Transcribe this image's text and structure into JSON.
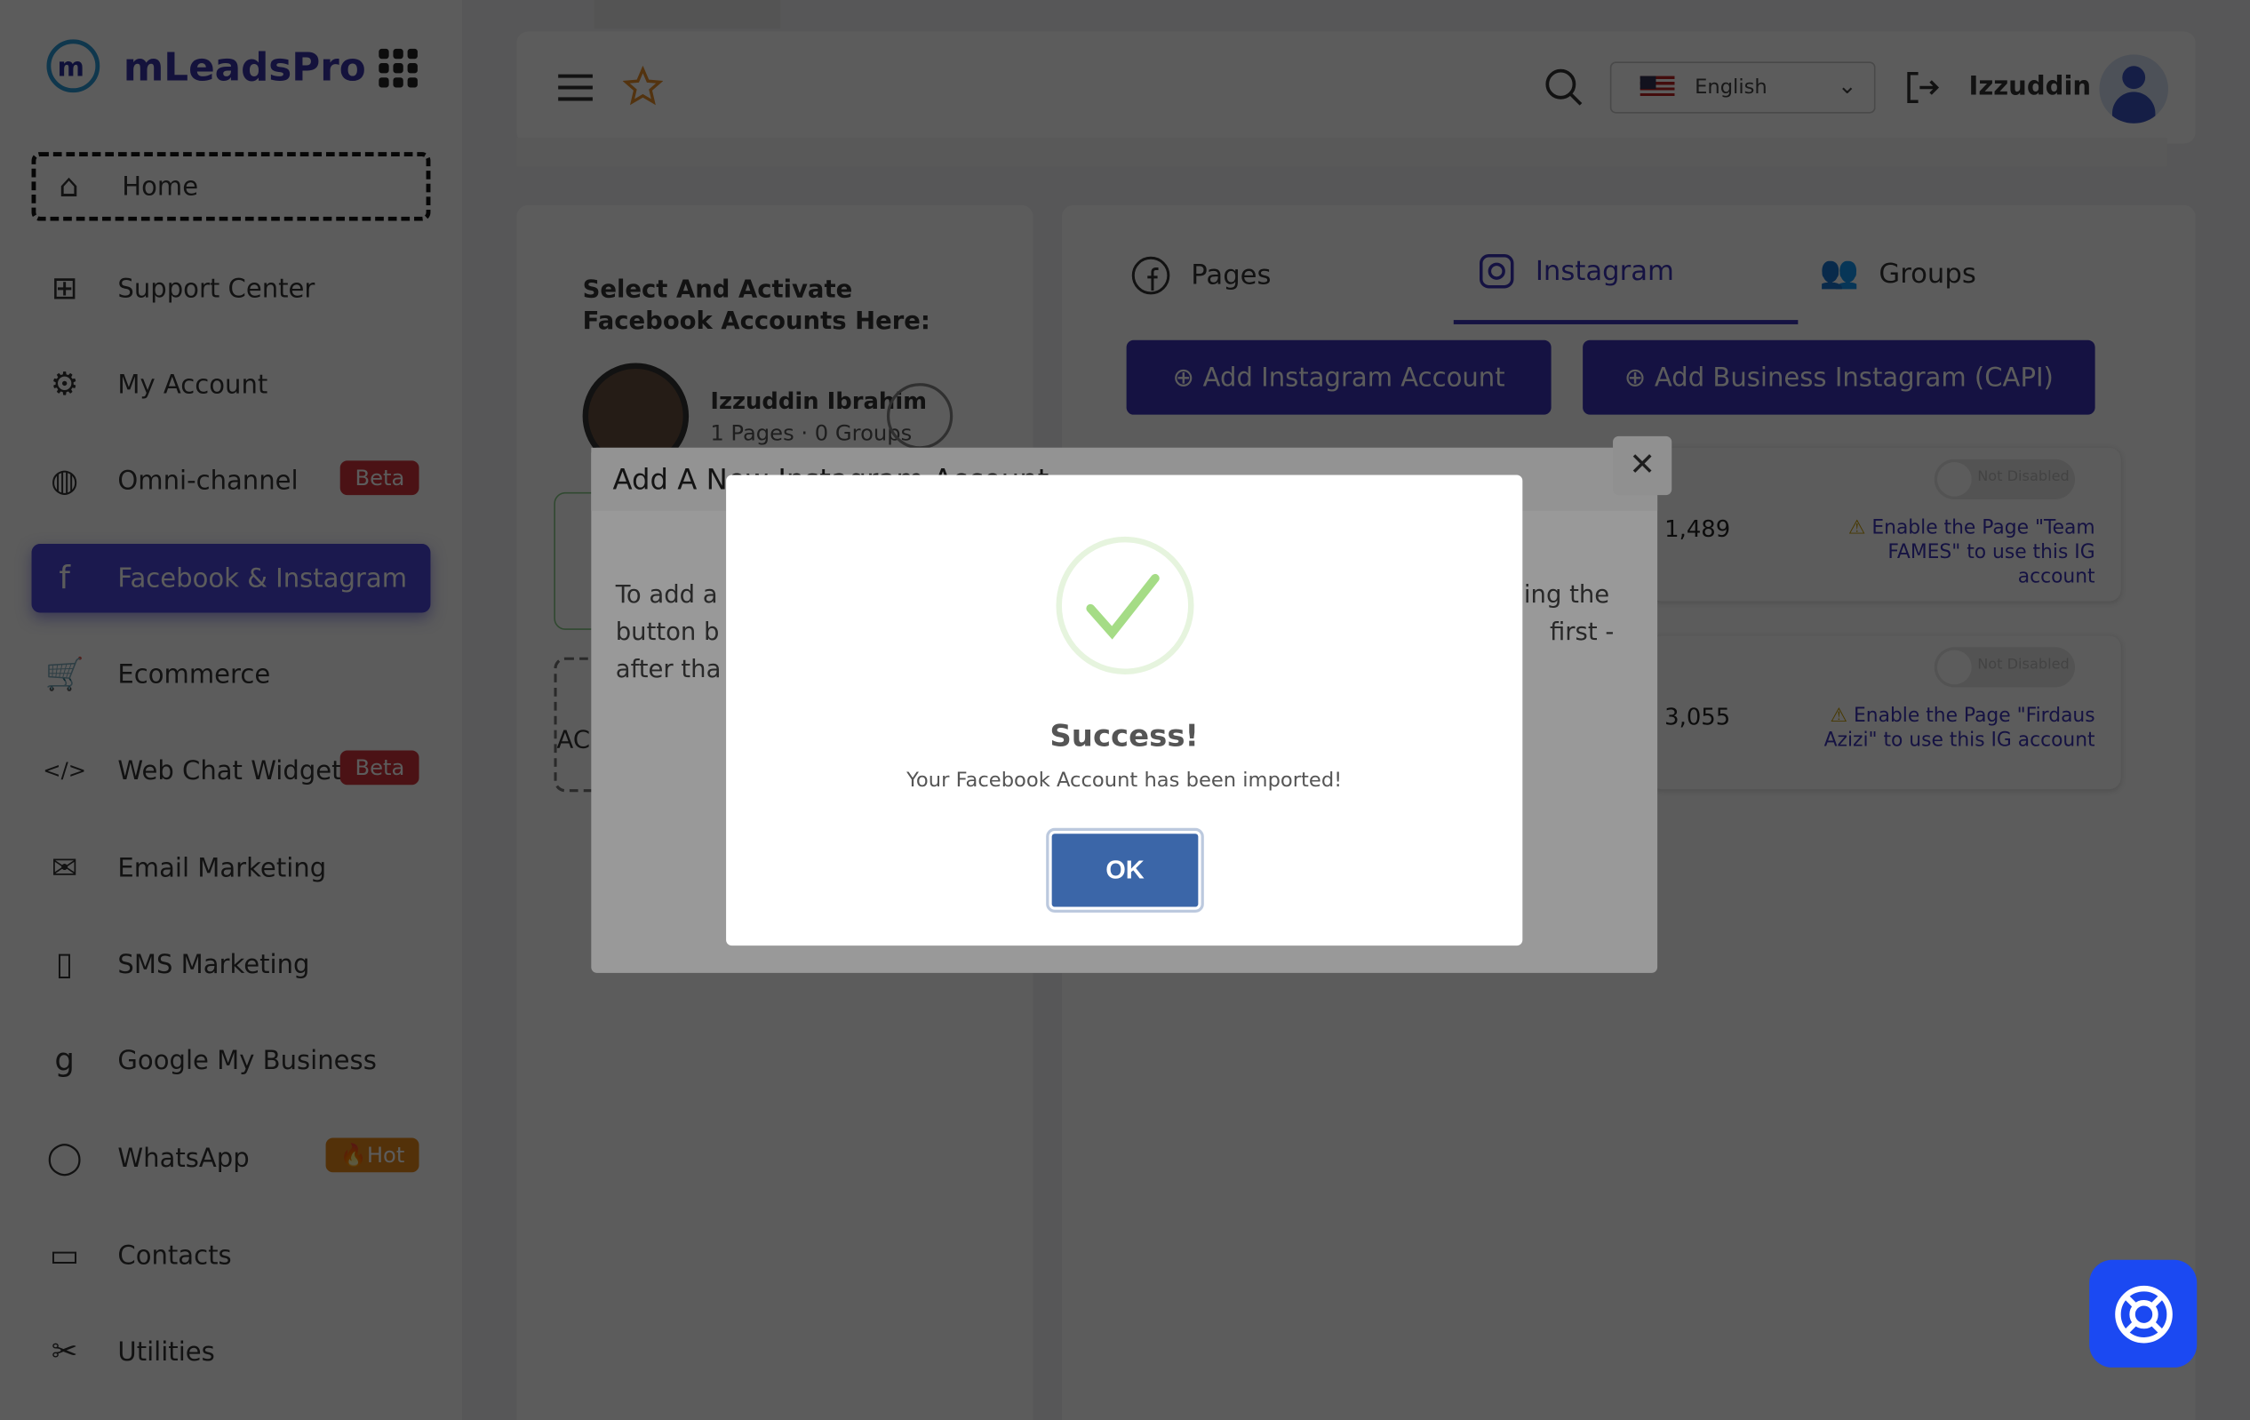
{
  "app": {
    "name": "mLeadsPro"
  },
  "sidebar": {
    "items": [
      {
        "label": "Home",
        "icon": "home-icon"
      },
      {
        "label": "Support Center",
        "icon": "medical-kit-icon"
      },
      {
        "label": "My Account",
        "icon": "gear-icon"
      },
      {
        "label": "Omni-channel",
        "icon": "globe-icon",
        "badge": "Beta"
      },
      {
        "label": "Facebook & Instagram",
        "icon": "facebook-icon",
        "active": true
      },
      {
        "label": "Ecommerce",
        "icon": "cart-icon"
      },
      {
        "label": "Web Chat Widget",
        "icon": "code-icon",
        "badge": "Beta"
      },
      {
        "label": "Email Marketing",
        "icon": "mail-icon"
      },
      {
        "label": "SMS Marketing",
        "icon": "phone-icon"
      },
      {
        "label": "Google My Business",
        "icon": "google-icon"
      },
      {
        "label": "WhatsApp",
        "icon": "whatsapp-icon",
        "badge": "🔥Hot"
      },
      {
        "label": "Contacts",
        "icon": "book-icon"
      },
      {
        "label": "Utilities",
        "icon": "tools-icon"
      }
    ]
  },
  "header": {
    "language": "English",
    "user": "Izzuddin"
  },
  "left_panel": {
    "title": "Select And Activate Facebook Accounts Here:",
    "account_name": "Izzuddin Ibrahim",
    "account_meta": "1 Pages · 0 Groups",
    "partial_add": "AC"
  },
  "tabs": [
    {
      "label": "Pages"
    },
    {
      "label": "Instagram",
      "active": true
    },
    {
      "label": "Groups"
    }
  ],
  "buttons": {
    "add_instagram": "Add Instagram Account",
    "add_business": "Add Business Instagram (CAPI)"
  },
  "ig_accounts": [
    {
      "count": "1,489",
      "toggle": "Not Disabled",
      "warning": "Enable the Page \"Team FAMES\" to use this IG account"
    },
    {
      "count": "3,055",
      "toggle": "Not Disabled",
      "warning": "Enable the Page \"Firdaus Azizi\" to use this IG account"
    }
  ],
  "ig_modal": {
    "title": "Add A New Instagram Account",
    "fragments": [
      "To add a",
      "button b",
      "after tha",
      "ing the",
      "first -"
    ]
  },
  "alert": {
    "title": "Success!",
    "message": "Your Facebook Account has been imported!",
    "ok": "OK"
  },
  "colors": {
    "accent": "#3b35b8",
    "ok_button": "#3b66a8",
    "support": "#1b49f2",
    "beta": "#d0353c",
    "hot": "#e88a1a"
  }
}
